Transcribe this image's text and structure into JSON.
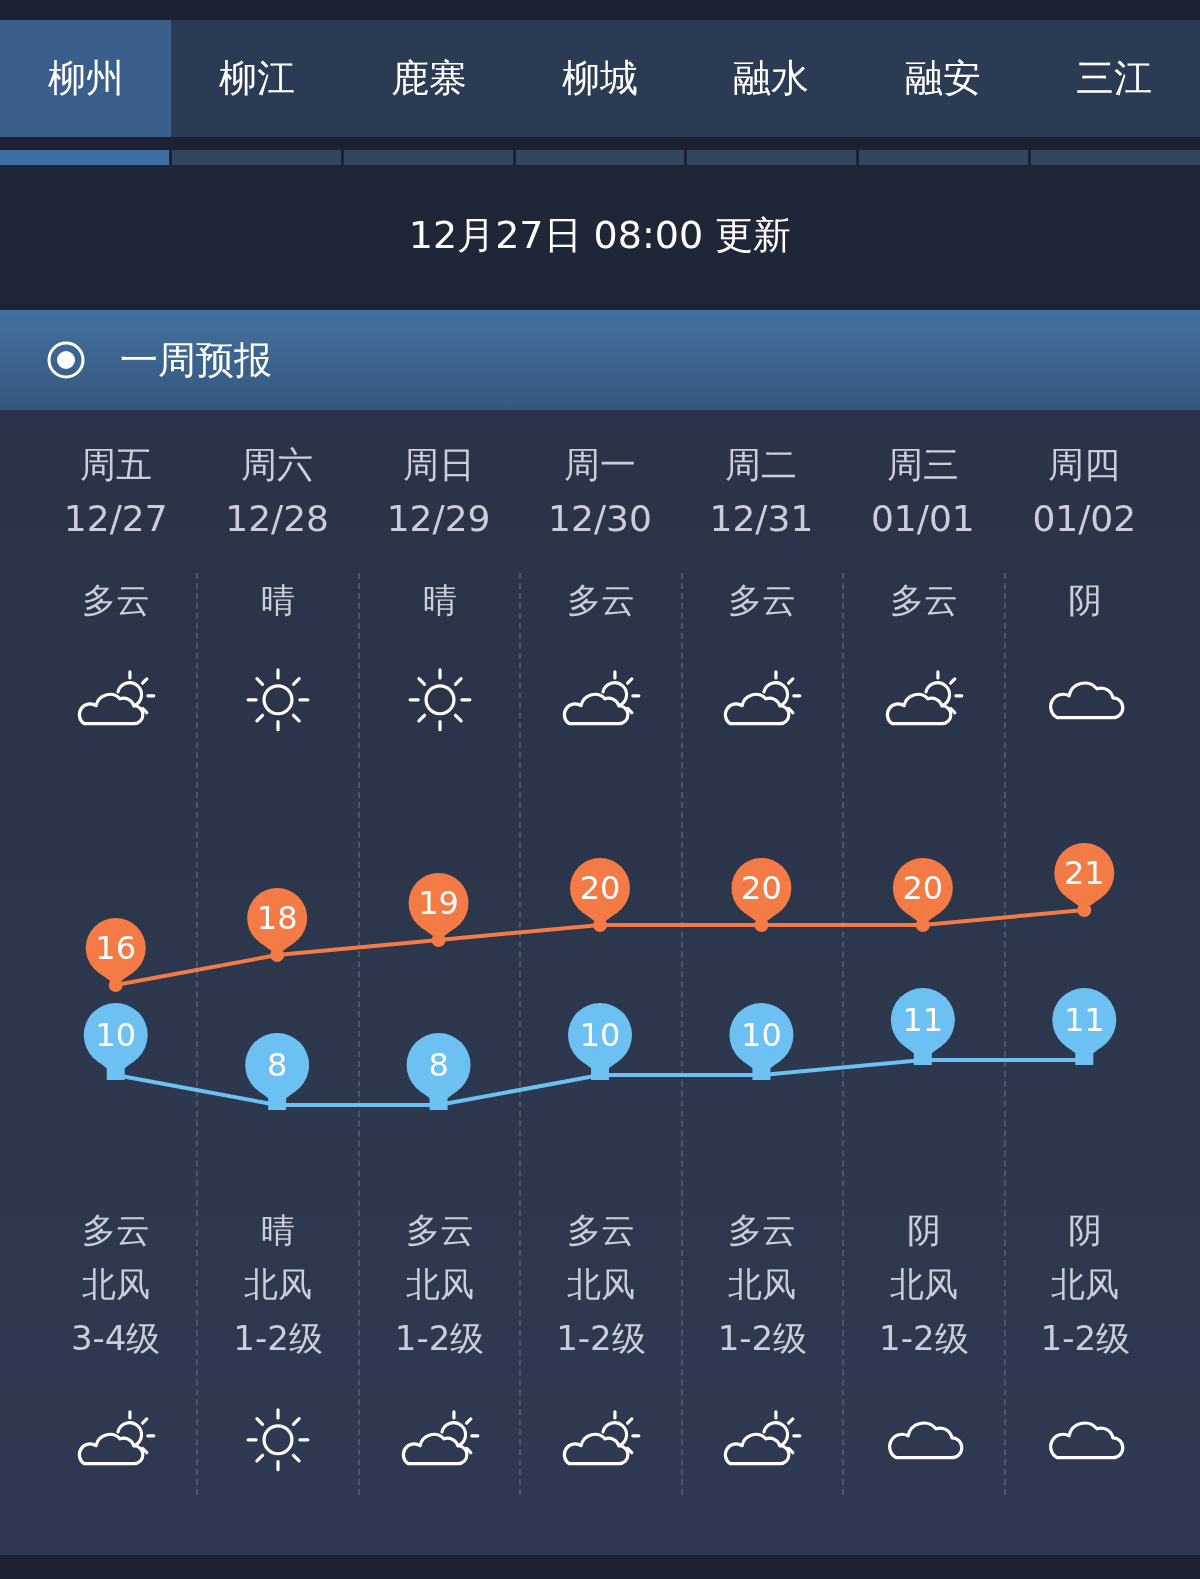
{
  "tabs": [
    {
      "label": "柳州",
      "selected": true
    },
    {
      "label": "柳江",
      "selected": false
    },
    {
      "label": "鹿寨",
      "selected": false
    },
    {
      "label": "柳城",
      "selected": false
    },
    {
      "label": "融水",
      "selected": false
    },
    {
      "label": "融安",
      "selected": false
    },
    {
      "label": "三江",
      "selected": false
    }
  ],
  "updated": "12月27日 08:00 更新",
  "section": {
    "title": "一周预报"
  },
  "forecast": {
    "days": [
      {
        "weekday": "周五",
        "date": "12/27",
        "day": {
          "weather": "多云",
          "kind": "partly_cloudy"
        },
        "high": "16",
        "low": "10",
        "night": {
          "weather": "多云",
          "kind": "partly_cloudy"
        },
        "wind": "北风",
        "wind_level": "3-4级"
      },
      {
        "weekday": "周六",
        "date": "12/28",
        "day": {
          "weather": "晴",
          "kind": "sunny"
        },
        "high": "18",
        "low": "8",
        "night": {
          "weather": "晴",
          "kind": "sunny"
        },
        "wind": "北风",
        "wind_level": "1-2级"
      },
      {
        "weekday": "周日",
        "date": "12/29",
        "day": {
          "weather": "晴",
          "kind": "sunny"
        },
        "high": "19",
        "low": "8",
        "night": {
          "weather": "多云",
          "kind": "partly_cloudy"
        },
        "wind": "北风",
        "wind_level": "1-2级"
      },
      {
        "weekday": "周一",
        "date": "12/30",
        "day": {
          "weather": "多云",
          "kind": "partly_cloudy"
        },
        "high": "20",
        "low": "10",
        "night": {
          "weather": "多云",
          "kind": "partly_cloudy"
        },
        "wind": "北风",
        "wind_level": "1-2级"
      },
      {
        "weekday": "周二",
        "date": "12/31",
        "day": {
          "weather": "多云",
          "kind": "partly_cloudy"
        },
        "high": "20",
        "low": "10",
        "night": {
          "weather": "多云",
          "kind": "partly_cloudy"
        },
        "wind": "北风",
        "wind_level": "1-2级"
      },
      {
        "weekday": "周三",
        "date": "01/01",
        "day": {
          "weather": "多云",
          "kind": "partly_cloudy"
        },
        "high": "20",
        "low": "11",
        "night": {
          "weather": "阴",
          "kind": "cloudy"
        },
        "wind": "北风",
        "wind_level": "1-2级"
      },
      {
        "weekday": "周四",
        "date": "01/02",
        "day": {
          "weather": "阴",
          "kind": "cloudy"
        },
        "high": "21",
        "low": "11",
        "night": {
          "weather": "阴",
          "kind": "cloudy"
        },
        "wind": "北风",
        "wind_level": "1-2级"
      }
    ]
  }
}
